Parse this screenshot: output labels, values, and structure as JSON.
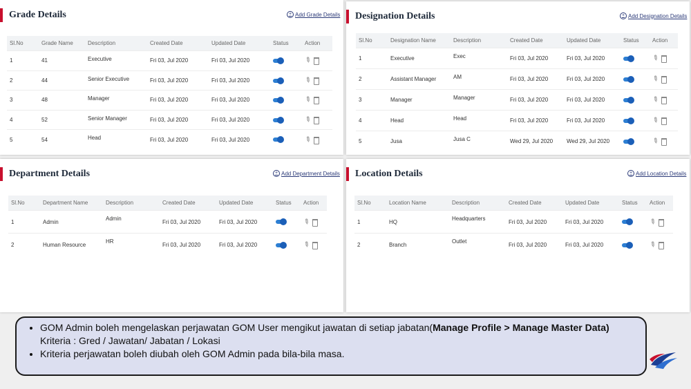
{
  "grade": {
    "title": "Grade Details",
    "add_label": "Add Grade Details",
    "columns": [
      "Sl.No",
      "Grade Name",
      "Description",
      "Created Date",
      "Updated Date",
      "Status",
      "Action"
    ],
    "rows": [
      [
        "1",
        "41",
        "Executive",
        "Fri 03, Jul 2020",
        "Fri 03, Jul 2020"
      ],
      [
        "2",
        "44",
        "Senior Executive",
        "Fri 03, Jul 2020",
        "Fri 03, Jul 2020"
      ],
      [
        "3",
        "48",
        "Manager",
        "Fri 03, Jul 2020",
        "Fri 03, Jul 2020"
      ],
      [
        "4",
        "52",
        "Senior Manager",
        "Fri 03, Jul 2020",
        "Fri 03, Jul 2020"
      ],
      [
        "5",
        "54",
        "Head",
        "Fri 03, Jul 2020",
        "Fri 03, Jul 2020"
      ]
    ]
  },
  "designation": {
    "title": "Designation Details",
    "add_label": "Add Designation Details",
    "columns": [
      "Sl.No",
      "Designation Name",
      "Description",
      "Created Date",
      "Updated Date",
      "Status",
      "Action"
    ],
    "rows": [
      [
        "1",
        "Executive",
        "Exec",
        "Fri 03, Jul 2020",
        "Fri 03, Jul 2020"
      ],
      [
        "2",
        "Assistant Manager",
        "AM",
        "Fri 03, Jul 2020",
        "Fri 03, Jul 2020"
      ],
      [
        "3",
        "Manager",
        "Manager",
        "Fri 03, Jul 2020",
        "Fri 03, Jul 2020"
      ],
      [
        "4",
        "Head",
        "Head",
        "Fri 03, Jul 2020",
        "Fri 03, Jul 2020"
      ],
      [
        "5",
        "Jusa",
        "Jusa C",
        "Wed 29, Jul 2020",
        "Wed 29, Jul 2020"
      ]
    ]
  },
  "department": {
    "title": "Department Details",
    "add_label": "Add Department Details",
    "columns": [
      "Sl.No",
      "Department Name",
      "Description",
      "Created Date",
      "Updated Date",
      "Status",
      "Action"
    ],
    "rows": [
      [
        "1",
        "Admin",
        "Admin",
        "Fri 03, Jul 2020",
        "Fri 03, Jul 2020"
      ],
      [
        "2",
        "Human Resource",
        "HR",
        "Fri 03, Jul 2020",
        "Fri 03, Jul 2020"
      ]
    ]
  },
  "location": {
    "title": "Location Details",
    "add_label": "Add Location Details",
    "columns": [
      "Sl.No",
      "Location Name",
      "Description",
      "Created Date",
      "Updated Date",
      "Status",
      "Action"
    ],
    "rows": [
      [
        "1",
        "HQ",
        "Headquarters",
        "Fri 03, Jul 2020",
        "Fri 03, Jul 2020"
      ],
      [
        "2",
        "Branch",
        "Outlet",
        "Fri 03, Jul 2020",
        "Fri 03, Jul 2020"
      ]
    ]
  },
  "note": {
    "bullet1_prefix": "GOM Admin boleh mengelaskan perjawatan GOM User mengikut jawatan di setiap jabatan(",
    "bullet1_bold": "Manage Profile > Manage Master Data)",
    "bullet1_line2": "Kriteria : Gred / Jawatan/ Jabatan / Lokasi",
    "bullet2": "Kriteria perjawatan boleh diubah oleh GOM Admin pada bila-bila masa."
  },
  "icons": {
    "status_toggle": "toggle-on-icon",
    "edit": "pencil-icon",
    "delete": "trash-icon",
    "logo": "airline-logo-icon"
  },
  "colors": {
    "accent": "#c8102e",
    "toggle": "#2d7fd3",
    "link": "#2b3a78",
    "note_bg": "#dcdff0"
  }
}
